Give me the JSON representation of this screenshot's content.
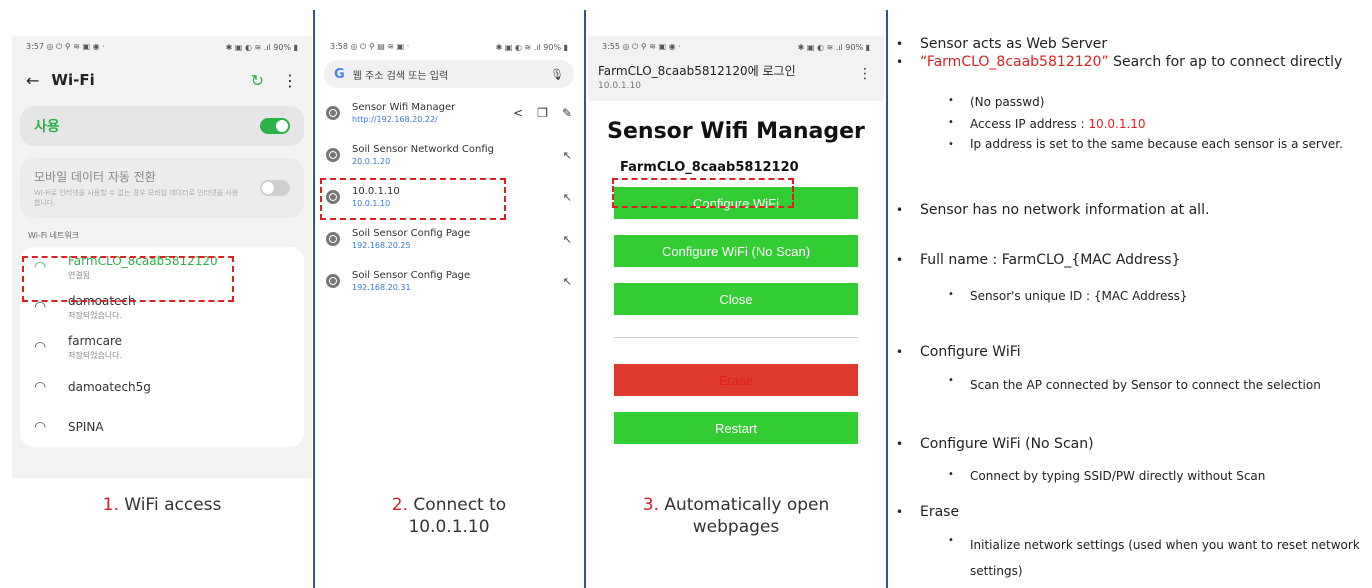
{
  "panel1": {
    "status_time": "3:57 ◎ ⏻ ⚲ ≋ ▣ ◉ ·",
    "status_right": "✱ ▣ ◐ ≋ .ıl 90% ▮",
    "title": "Wi-Fi",
    "use_label": "사용",
    "mobile_title": "모바일 데이터 자동 전환",
    "mobile_desc": "Wi-Fi로 인터넷을 사용할 수 없는 경우 모바일 데이터로 인터넷을 사용합니다.",
    "section": "Wi-Fi 네트워크",
    "networks": [
      {
        "name": "FarmCLO_8caab5812120",
        "sub": "연결됨"
      },
      {
        "name": "damoatech",
        "sub": "저장되었습니다."
      },
      {
        "name": "farmcare",
        "sub": "저장되었습니다."
      },
      {
        "name": "damoatech5g",
        "sub": ""
      },
      {
        "name": "SPINA",
        "sub": ""
      }
    ],
    "caption_num": "1.",
    "caption_text": " WiFi access"
  },
  "panel2": {
    "status_time": "3:58 ◎ ⏻ ⚲ ▤ ≋ ▣ ·",
    "status_right": "✱ ▣ ◐ ≋ .ıl 90% ▮",
    "search_placeholder": "웹 주소 검색 또는 입력",
    "items": [
      {
        "title": "Sensor Wifi Manager",
        "url": "http://192.168.20.22/"
      },
      {
        "title": "Soil Sensor Networkd Config",
        "url": "20.0.1.20"
      },
      {
        "title": "10.0.1.10",
        "url": "10.0.1.10"
      },
      {
        "title": "Soil Sensor Config Page",
        "url": "192.168.20.25"
      },
      {
        "title": "Soil Sensor Config Page",
        "url": "192.168.20.31"
      }
    ],
    "caption_num": "2.",
    "caption_text": " Connect to",
    "caption_line2": "10.0.1.10"
  },
  "panel3": {
    "status_time": "3:55 ◎ ⏻ ⚲ ≋ ▣ ◉ ·",
    "status_right": "✱ ▣ ◐ ≋ .ıl 90% ▮",
    "login_title": "FarmCLO_8caab5812120에 로그인",
    "login_ip": "10.0.1.10",
    "heading": "Sensor Wifi Manager",
    "ssid": "FarmCLO_8caab5812120",
    "btn_configure": "Configure WiFi",
    "btn_configure_noscan": "Configure WiFi (No Scan)",
    "btn_close": "Close",
    "btn_erase": "Erase",
    "btn_restart": "Restart",
    "caption_num": "3.",
    "caption_text": " Automatically open",
    "caption_line2": "webpages"
  },
  "notes": {
    "n1": "Sensor acts as Web Server",
    "n2_quote": "“FarmCLO_8caab5812120”",
    "n2_rest": " Search for ap to connect directly",
    "n2a": "(No passwd)",
    "n2b_label": "Access IP address : ",
    "n2b_value": "10.0.1.10",
    "n2c": "Ip address is set to the same because each sensor is a server.",
    "n3": "Sensor has no network information at all.",
    "n4": "Full name : FarmCLO_{MAC Address}",
    "n4a": "Sensor's unique ID : {MAC Address}",
    "n5": "Configure WiFi",
    "n5a": "Scan the AP connected by Sensor to connect the selection",
    "n6": "Configure WiFi (No Scan)",
    "n6a": "Connect by typing SSID/PW directly without Scan",
    "n7": "Erase",
    "n7a": "Initialize network settings (used when you want to reset network settings)"
  },
  "colors": {
    "accent_green": "#33cc33",
    "erase_red": "#e03a2e",
    "divider_blue": "#2f5597",
    "highlight_red": "#e02020"
  }
}
